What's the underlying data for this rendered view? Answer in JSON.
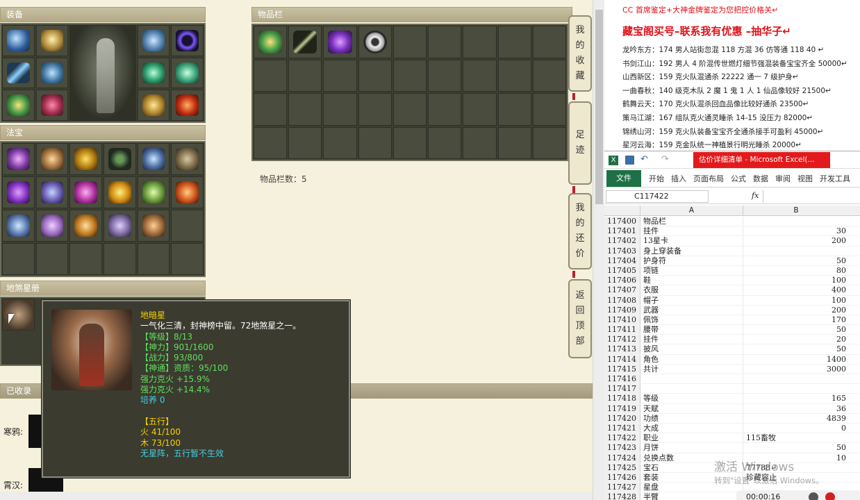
{
  "game": {
    "equip_header": "装备",
    "treasure_header": "法宝",
    "star_header": "地煞星册",
    "collected_header": "已收录",
    "inventory_header": "物品栏",
    "inventory_count_label": "物品栏数：5",
    "char_label_1": "寒鸦:",
    "char_label_2": "霄汉:",
    "side_buttons": [
      "我的收藏",
      "足迹",
      "我的还价",
      "返回顶部"
    ],
    "tooltip": {
      "name": "地暗星",
      "desc": "一气化三清，封神榜中留。72地煞星之一。",
      "lines": [
        {
          "text": "【等级】8/13",
          "color": "#5fe05a"
        },
        {
          "text": "【神力】901/1600",
          "color": "#5fe05a"
        },
        {
          "text": "【战力】93/800",
          "color": "#5fe05a"
        },
        {
          "text": "【神通】资质：95/100",
          "color": "#5fe05a"
        },
        {
          "text": "强力克火 +15.9%",
          "color": "#5fe05a"
        },
        {
          "text": "强力克火 +14.4%",
          "color": "#5fe05a"
        },
        {
          "text": "培养 0",
          "color": "#40d0e0"
        },
        {
          "text": "",
          "color": "#ffffff"
        },
        {
          "text": "【五行】",
          "color": "#f5d000"
        },
        {
          "text": "火 41/100",
          "color": "#f5d000"
        },
        {
          "text": "木 73/100",
          "color": "#f5d000"
        },
        {
          "text": "无星阵，五行暂不生效",
          "color": "#40d0e0"
        }
      ]
    },
    "colors": {
      "gold": "#f5d000",
      "green": "#5fe05a",
      "cyan": "#40d0e0"
    }
  },
  "notes": {
    "top_line": "CC 首席鉴定+大神金牌鉴定为您把控价格关↵",
    "headline": "藏宝阁买号–联系我有优惠 –抽华子↵",
    "lines": [
      "龙吟东方：174 男人站街忽混 118 方混 36 仿等通 118 40 ↵",
      "书剑江山：192 男人 4 阶混传世燃灯细节强混装备宝宝齐全 50000↵",
      "山西新区：159 克火队混通杀 22222 通一 7 级护身↵",
      "一曲春秋：140 级克木队 2 魔 1 鬼 1 人 1 仙品像较好 21500↵",
      "鹤舞云天：170 克火队混杀回血品像比较好通杀 23500↵",
      "策马江湖：167 组队克火通灵睡杀 14-15 没压力 82000↵",
      "锦绣山河：159 克火队装备宝宝齐全通杀接手可盈利 45000↵",
      "星河云海：159 克金队统一神植景行明光睡杀 20000↵"
    ]
  },
  "excel": {
    "title": "估价详细清单 - Microsoft Excel(...",
    "tabs": [
      "文件",
      "开始",
      "插入",
      "页面布局",
      "公式",
      "数据",
      "审阅",
      "视图",
      "开发工具"
    ],
    "name_box": "C117422",
    "fx": "fx",
    "col_a": "A",
    "col_b": "B",
    "rows": [
      [
        "117400",
        "物品栏",
        ""
      ],
      [
        "117401",
        "挂件",
        "30"
      ],
      [
        "117402",
        "13星卡",
        "200"
      ],
      [
        "117403",
        "身上穿装备",
        ""
      ],
      [
        "117404",
        "护身符",
        "50"
      ],
      [
        "117405",
        "项链",
        "80"
      ],
      [
        "117406",
        "鞋",
        "100"
      ],
      [
        "117407",
        "衣服",
        "400"
      ],
      [
        "117408",
        "帽子",
        "100"
      ],
      [
        "117409",
        "武器",
        "200"
      ],
      [
        "117410",
        "佩饰",
        "170"
      ],
      [
        "117411",
        "腰带",
        "50"
      ],
      [
        "117412",
        "挂件",
        "20"
      ],
      [
        "117413",
        "披风",
        "50"
      ],
      [
        "117414",
        "角色",
        "1400"
      ],
      [
        "117415",
        "共计",
        "3000"
      ],
      [
        "117416",
        "",
        ""
      ],
      [
        "117417",
        "",
        ""
      ],
      [
        "117418",
        "等级",
        "165"
      ],
      [
        "117419",
        "天赋",
        "36"
      ],
      [
        "117420",
        "功绩",
        "4839"
      ],
      [
        "117421",
        "大成",
        "0"
      ],
      [
        "117422",
        "职业",
        "115畜牧"
      ],
      [
        "117423",
        "月饼",
        "50"
      ],
      [
        "117424",
        "兑换点数",
        "10"
      ],
      [
        "117425",
        "宝石",
        "77788↵"
      ],
      [
        "117426",
        "套装",
        "珍藏容止"
      ],
      [
        "117427",
        "星盘",
        ""
      ],
      [
        "117428",
        "半臂",
        ""
      ]
    ],
    "watermark_1": "激活 Windows",
    "watermark_2": "转到\"设置\"以激活 Windows。",
    "timer": "00:00:16"
  }
}
